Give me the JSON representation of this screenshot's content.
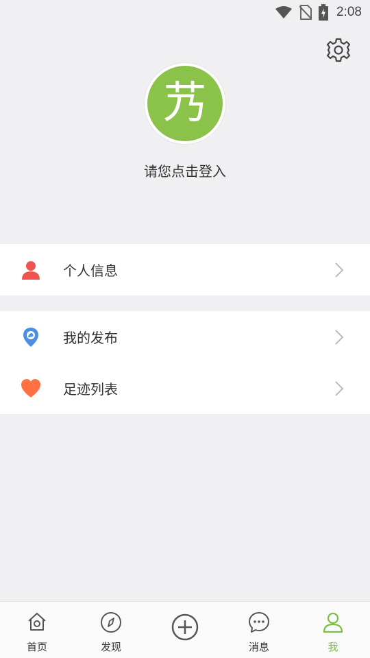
{
  "status_bar": {
    "time": "2:08",
    "icons": [
      "wifi-icon",
      "no-sim-icon",
      "battery-charging-icon"
    ]
  },
  "header": {
    "settings_icon": "gear-icon"
  },
  "profile": {
    "avatar_glyph": "艿",
    "avatar_color": "#8bc34a",
    "login_prompt": "请您点击登入"
  },
  "menu": {
    "group1": [
      {
        "label": "个人信息",
        "icon": "person-icon",
        "color": "#ef5350"
      }
    ],
    "group2": [
      {
        "label": "我的发布",
        "icon": "location-pin-icon",
        "color": "#4a90e2"
      },
      {
        "label": "足迹列表",
        "icon": "heart-icon",
        "color": "#ff7043"
      }
    ]
  },
  "bottom_nav": {
    "items": [
      {
        "label": "首页",
        "icon": "home-icon"
      },
      {
        "label": "发现",
        "icon": "compass-icon"
      },
      {
        "label": "",
        "icon": "add-circle-icon"
      },
      {
        "label": "消息",
        "icon": "chat-bubble-icon"
      },
      {
        "label": "我",
        "icon": "user-icon",
        "active": true
      }
    ],
    "active_color": "#7cbf46"
  }
}
